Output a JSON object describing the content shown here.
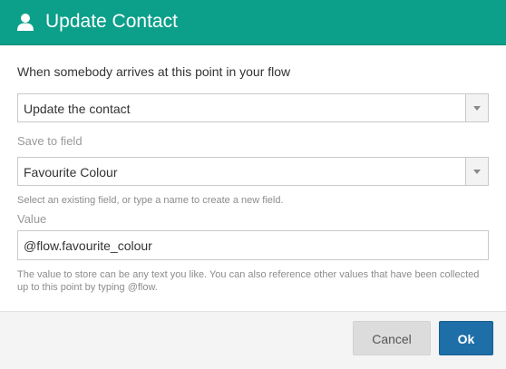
{
  "header": {
    "title": "Update Contact",
    "icon": "person-icon",
    "color": "#0c9f8a"
  },
  "intro_text": "When somebody arrives at this point in your flow",
  "action_select": {
    "value": "Update the contact"
  },
  "save_field": {
    "label": "Save to field",
    "value": "Favourite Colour",
    "hint": "Select an existing field, or type a name to create a new field."
  },
  "value_field": {
    "label": "Value",
    "value": "@flow.favourite_colour",
    "hint": "The value to store can be any text you like. You can also reference other values that have been collected up to this point by typing @flow."
  },
  "footer": {
    "cancel_label": "Cancel",
    "ok_label": "Ok",
    "ok_color": "#1e6ea7"
  }
}
